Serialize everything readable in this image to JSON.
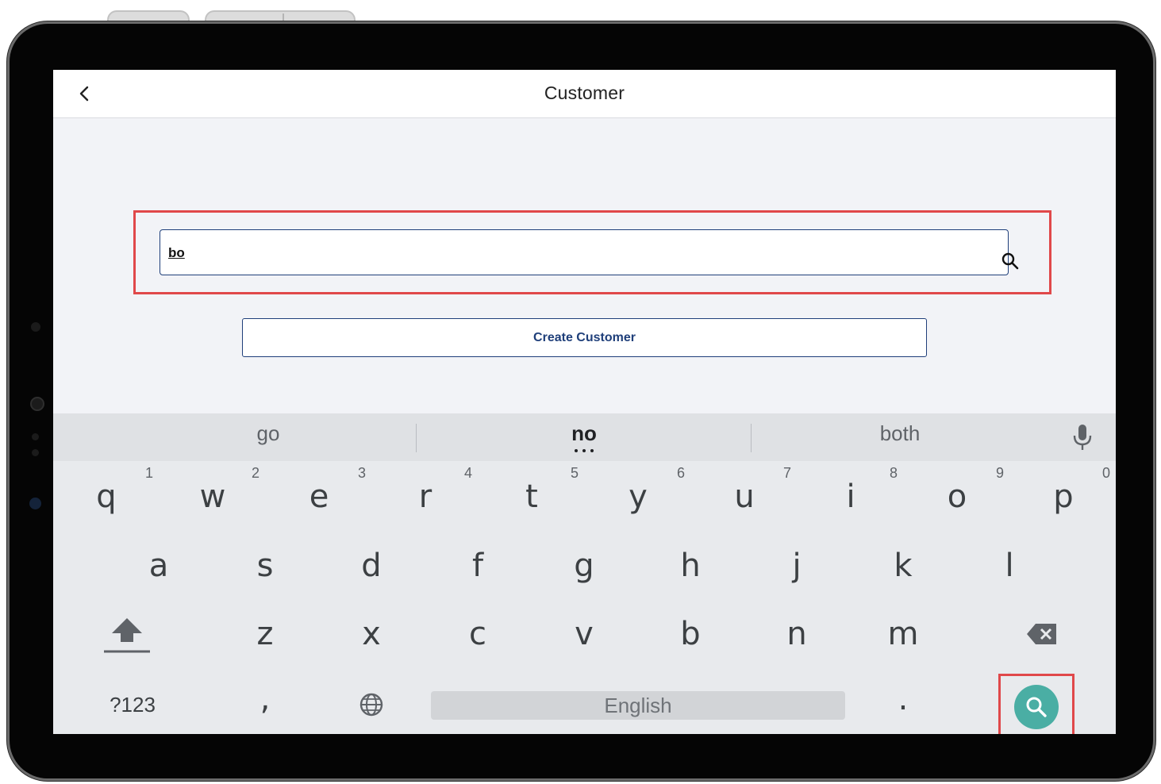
{
  "header": {
    "title": "Customer"
  },
  "search": {
    "value": "bo"
  },
  "actions": {
    "create_label": "Create Customer"
  },
  "keyboard": {
    "suggestions": [
      "go",
      "no",
      "both"
    ],
    "row1": [
      {
        "char": "q",
        "hint": "1"
      },
      {
        "char": "w",
        "hint": "2"
      },
      {
        "char": "e",
        "hint": "3"
      },
      {
        "char": "r",
        "hint": "4"
      },
      {
        "char": "t",
        "hint": "5"
      },
      {
        "char": "y",
        "hint": "6"
      },
      {
        "char": "u",
        "hint": "7"
      },
      {
        "char": "i",
        "hint": "8"
      },
      {
        "char": "o",
        "hint": "9"
      },
      {
        "char": "p",
        "hint": "0"
      }
    ],
    "row2": [
      "a",
      "s",
      "d",
      "f",
      "g",
      "h",
      "j",
      "k",
      "l"
    ],
    "row3": [
      "z",
      "x",
      "c",
      "v",
      "b",
      "n",
      "m"
    ],
    "symbols_label": "?123",
    "comma": ",",
    "period": ".",
    "space_label": "English"
  },
  "colors": {
    "accent": "#1f3f7a",
    "highlight": "#e0484a",
    "enter_key": "#4aaea4",
    "keyboard_bg": "#e8eaed"
  },
  "icons": [
    "back-chevron-icon",
    "search-icon",
    "mic-icon",
    "shift-icon",
    "backspace-icon",
    "globe-icon",
    "enter-search-icon"
  ]
}
